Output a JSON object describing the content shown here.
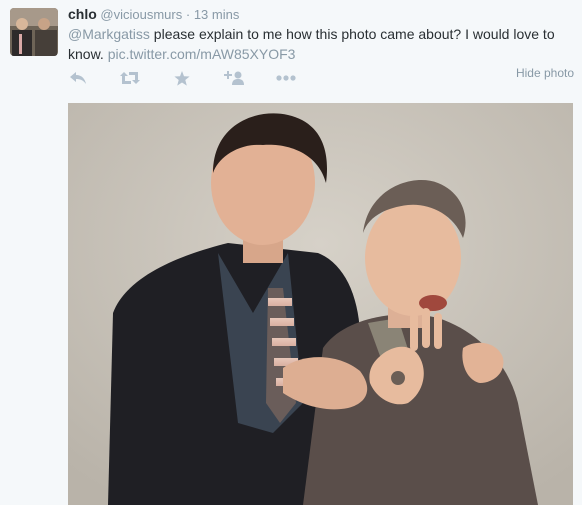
{
  "tweet": {
    "fullname": "chlo",
    "username": "@viciousmurs",
    "time_separator": "·",
    "timestamp": "13 mins",
    "text_mention": "@Markgatiss",
    "text_body": " please explain to me how this photo came about? I would love to know. ",
    "text_link": "pic.twitter.com/mAW85XYOF3"
  },
  "actions": {
    "reply_icon": "reply-icon",
    "retweet_icon": "retweet-icon",
    "favorite_icon": "star-icon",
    "follow_icon": "add-user-icon",
    "more_icon": "more-icon"
  },
  "media": {
    "hide_label": "Hide photo"
  },
  "colors": {
    "background": "#f5f8fa",
    "text": "#292f33",
    "muted": "#8899a6",
    "icon": "#b4c2cf",
    "photo_backdrop": "#c9c3b8"
  }
}
